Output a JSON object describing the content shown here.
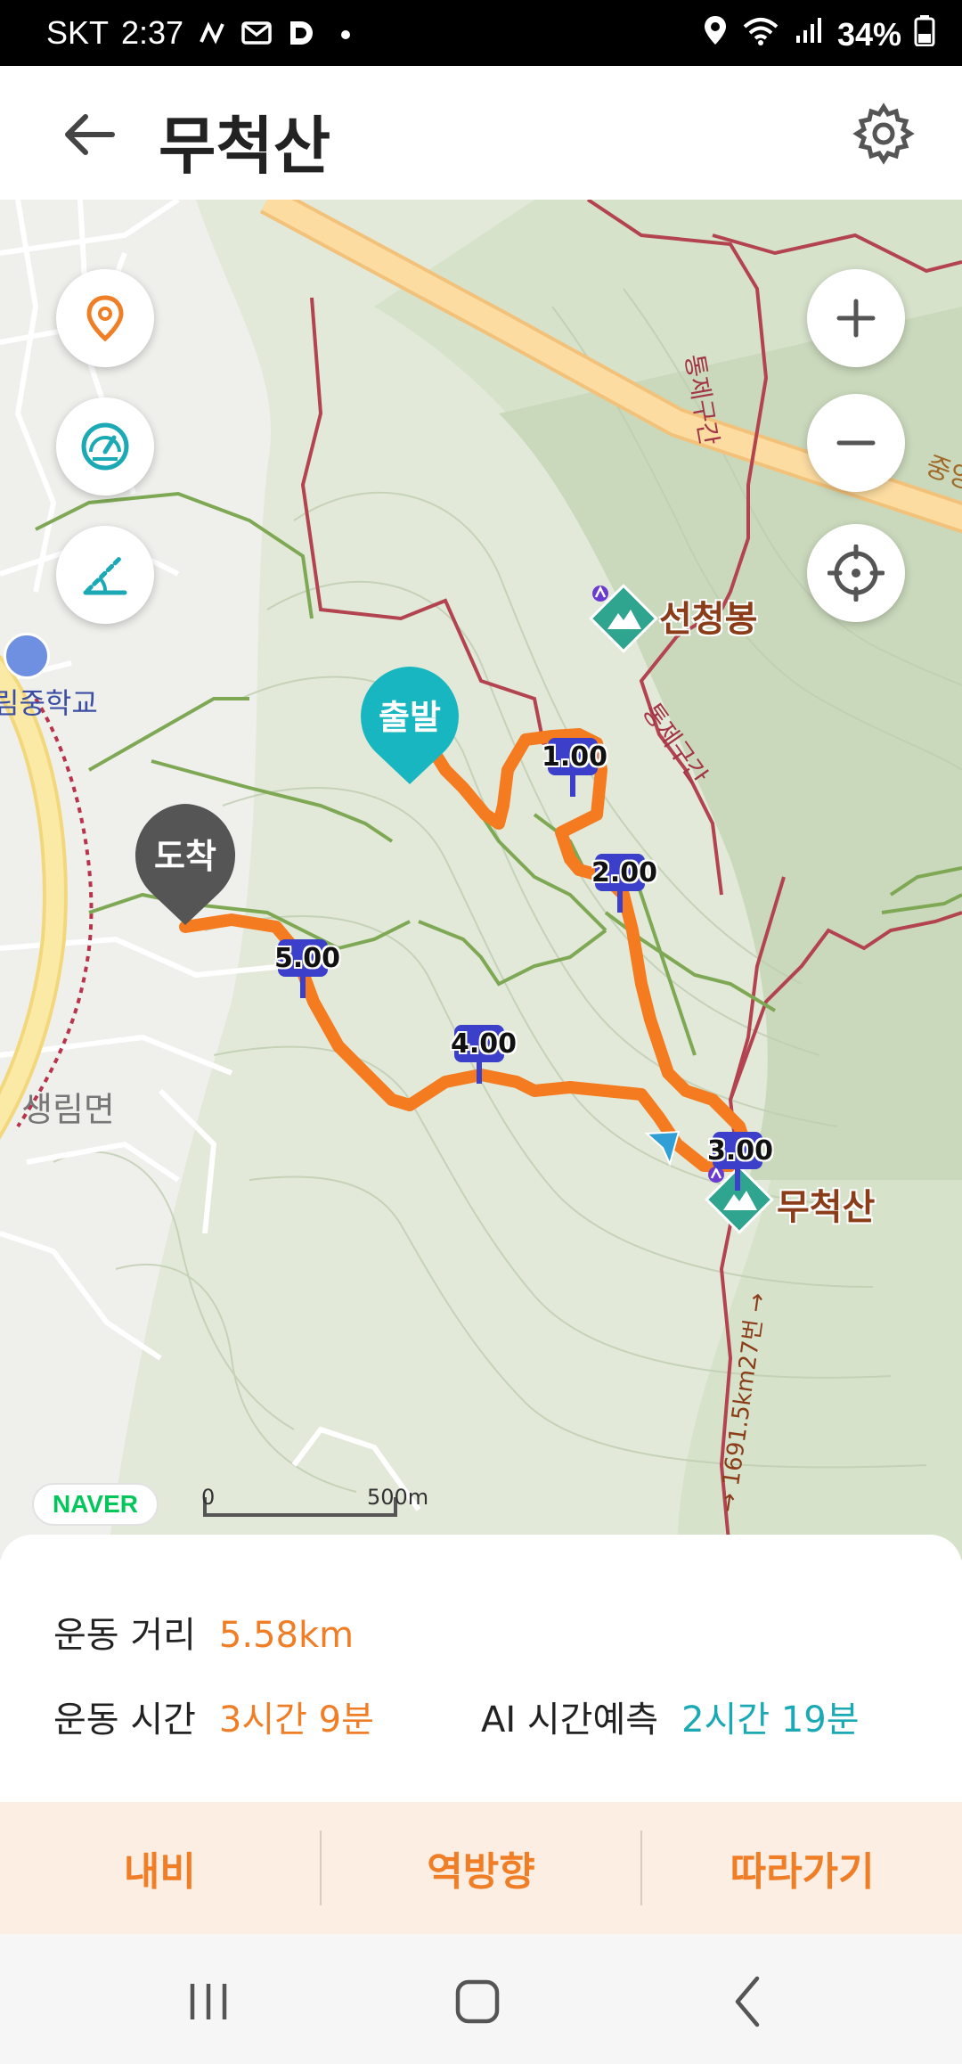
{
  "status_bar": {
    "carrier": "SKT",
    "time": "2:37",
    "battery": "34%",
    "icons": [
      "activity-icon",
      "mail-icon",
      "d-app-icon",
      "dot-icon",
      "location-icon",
      "wifi-icon",
      "signal-icon",
      "battery-icon"
    ]
  },
  "header": {
    "title": "무척산",
    "back_icon": "arrow-left-icon",
    "settings_icon": "gear-icon"
  },
  "map": {
    "buttons": {
      "location": "location-pin-icon",
      "speedometer": "speedometer-icon",
      "elevation": "elevation-icon",
      "zoom_in": "+",
      "zoom_out": "−",
      "my_location": "crosshair-icon"
    },
    "start_label": "출발",
    "end_label": "도착",
    "peak_labels": {
      "seoncheongbong": "선청봉",
      "mucheoksan": "무척산"
    },
    "place_labels": {
      "school": "림중학교",
      "town": "생림면",
      "road_edge": "중앙"
    },
    "road_labels": {
      "control_1": "통제구간",
      "control_2": "통제구간",
      "highway": "→ 1691.5km27번 →"
    },
    "km_markers": [
      "1.00",
      "2.00",
      "3.00",
      "4.00",
      "5.00"
    ],
    "naver": "NAVER",
    "scale": {
      "start": "0",
      "end": "500m"
    },
    "colors": {
      "route": "#f47b20",
      "start_pin": "#17b6c0",
      "end_pin": "#555555",
      "km_flag": "#3b3fc9",
      "peak": "#2fa48f"
    }
  },
  "info": {
    "distance_label": "운동 거리",
    "distance_value": "5.58km",
    "time_label": "운동 시간",
    "time_value": "3시간 9분",
    "ai_label": "AI 시간예측",
    "ai_value": "2시간 19분"
  },
  "actions": {
    "navi": "내비",
    "reverse": "역방향",
    "follow": "따라가기"
  },
  "nav_bar": {
    "recent": "recent-apps-icon",
    "home": "home-icon",
    "back": "back-icon"
  }
}
